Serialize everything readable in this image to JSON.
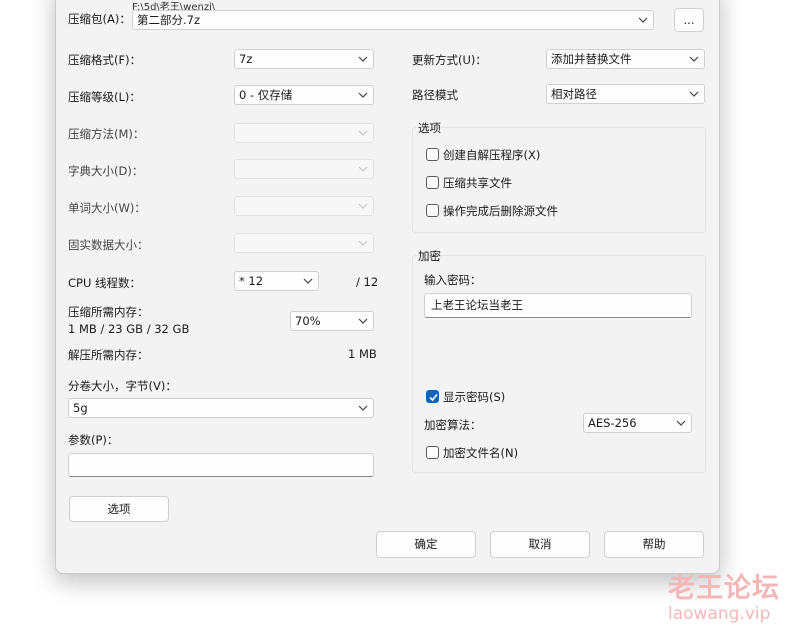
{
  "archive": {
    "label": "压缩包(A)：",
    "path_partial": "F:\\5d\\老王\\wenzi\\",
    "filename": "第二部分.7z",
    "browse_label": "..."
  },
  "left": {
    "format": {
      "label": "压缩格式(F)：",
      "value": "7z"
    },
    "level": {
      "label": "压缩等级(L)：",
      "value": "0 - 仅存储"
    },
    "method": {
      "label": "压缩方法(M)：",
      "value": ""
    },
    "dict": {
      "label": "字典大小(D)：",
      "value": ""
    },
    "word": {
      "label": "单词大小(W)：",
      "value": ""
    },
    "solid": {
      "label": "固实数据大小：",
      "value": ""
    },
    "threads": {
      "label": "CPU 线程数：",
      "value": "* 12",
      "max": "/ 12"
    },
    "mem_compress": {
      "label": "压缩所需内存：",
      "detail": "1 MB / 23 GB / 32 GB",
      "value": "70%"
    },
    "mem_decompress": {
      "label": "解压所需内存：",
      "value": "1 MB"
    },
    "volume": {
      "label": "分卷大小，字节(V)：",
      "value": "5g"
    },
    "params": {
      "label": "参数(P)：",
      "value": ""
    },
    "options_button": "选项"
  },
  "right": {
    "update": {
      "label": "更新方式(U)：",
      "value": "添加并替换文件"
    },
    "path_mode": {
      "label": "路径模式",
      "value": "相对路径"
    },
    "options_group": {
      "title": "选项",
      "sfx": "创建自解压程序(X)",
      "shared": "压缩共享文件",
      "delete_after": "操作完成后删除源文件"
    },
    "encryption": {
      "title": "加密",
      "password_label": "输入密码：",
      "password_value": "上老王论坛当老王",
      "show_password": "显示密码(S)",
      "method_label": "加密算法：",
      "method_value": "AES-256",
      "encrypt_names": "加密文件名(N)"
    }
  },
  "buttons": {
    "ok": "确定",
    "cancel": "取消",
    "help": "帮助"
  },
  "watermark": {
    "cn": "老王论坛",
    "en": "laowang.vip"
  },
  "colors": {
    "accent": "#0a64c2",
    "dialog_bg": "#f3f3f3",
    "watermark": "#f2b8b8"
  }
}
